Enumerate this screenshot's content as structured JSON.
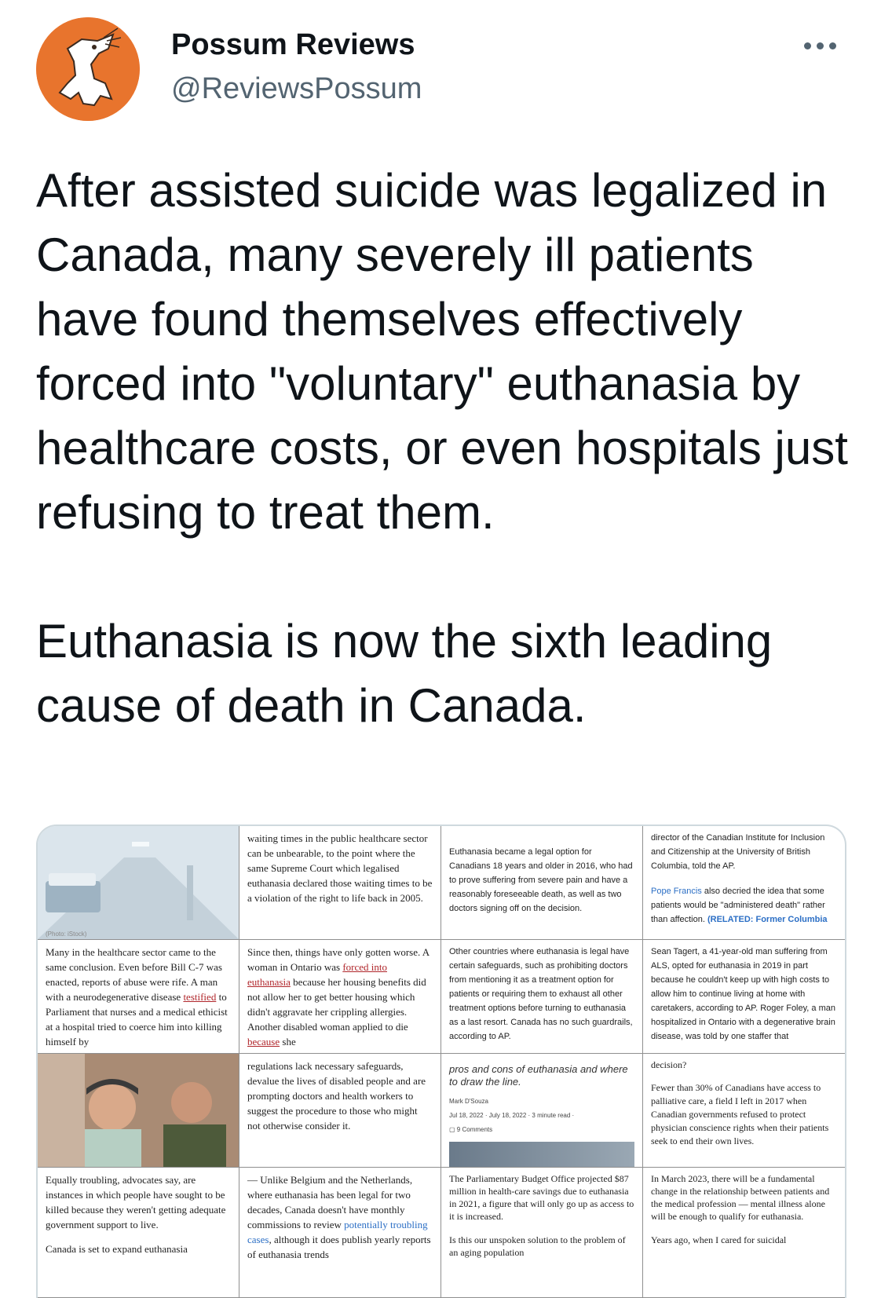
{
  "author": {
    "display_name": "Possum Reviews",
    "handle": "@ReviewsPossum",
    "avatar_icon": "possum-avatar-icon",
    "avatar_bg": "#e8742d"
  },
  "more_icon": "more-options-icon",
  "tweet": {
    "paragraph1": "After assisted suicide was legalized in Canada, many severely ill patients have found themselves effectively forced into \"voluntary\" euthanasia by healthcare costs, or even hospitals just refusing to treat them.",
    "paragraph2": "Euthanasia is now the sixth leading cause of death in Canada."
  },
  "collage": {
    "c1_credit": "(Photo: iStock)",
    "c2_text": "waiting times in the public healthcare sector can be unbearable, to the point where the same Supreme Court which legalised euthanasia declared those waiting times to be a violation of the right to life back in 2005.",
    "c3_text": "Euthanasia became a legal option for Canadians 18 years and older in 2016, who had to prove suffering from severe pain and have a reasonably foreseeable death, as well as two doctors signing off on the decision.",
    "c4_a": "director of the Canadian Institute for Inclusion and Citizenship at the University of British Columbia, told the AP.",
    "c4_b_link": "Pope Francis",
    "c4_b": " also decried the idea that some patients would be \"administered death\" rather than affection.",
    "c4_related": "(RELATED: Former Columbia",
    "c5_pre": "Many in the healthcare sector came to the same conclusion. Even before Bill C-7 was enacted, reports of abuse were rife. A man with a neurodegenerative disease ",
    "c5_link": "testified",
    "c5_post": " to Parliament that nurses and a medical ethicist at a hospital tried to coerce him into killing himself by",
    "c6_pre": "Since then, things have only gotten worse. A woman in Ontario was ",
    "c6_link": "forced into euthanasia",
    "c6_mid": " because her housing benefits did not allow her to get better housing which didn't aggravate her crippling allergies. Another disabled woman applied to die ",
    "c6_link2": "because",
    "c6_post": " she",
    "c7_text": "Other countries where euthanasia is legal have certain safeguards, such as prohibiting doctors from mentioning it as a treatment option for patients or requiring them to exhaust all other treatment options before turning to euthanasia as a last resort. Canada has no such guardrails, according to AP.",
    "c8_text": "Sean Tagert, a 41-year-old man suffering from ALS, opted for euthanasia in 2019 in part because he couldn't keep up with high costs to allow him to continue living at home with caretakers, according to AP. Roger Foley, a man hospitalized in Ontario with a degenerative brain disease, was told by one staffer that",
    "c10_text": "regulations lack necessary safeguards, devalue the lives of disabled people and are prompting doctors and health workers to suggest the procedure to those who might not otherwise consider it.",
    "c11_headline": "pros and cons of euthanasia and where to draw the line.",
    "c11_author": "Mark D'Souza",
    "c11_meta": "Jul 18, 2022 · July 18, 2022 · 3 minute read ·",
    "c11_comments": "9 Comments",
    "c12_a": "decision?",
    "c12_b": "Fewer than 30% of Canadians have access to palliative care, a field I left in 2017 when Canadian governments refused to protect physician conscience rights when their patients seek to end their own lives.",
    "c13_text": "Equally troubling, advocates say, are instances in which people have sought to be killed because they weren't getting adequate government support to live.",
    "c13_tail": "Canada is set to expand euthanasia",
    "c14_pre": "— Unlike Belgium and the Netherlands, where euthanasia has been legal for two decades, Canada doesn't have monthly commissions to review ",
    "c14_link": "potentially troubling cases",
    "c14_post": ", although it does publish yearly reports of euthanasia trends",
    "c15_a": "The Parliamentary Budget Office projected $87 million in health-care savings due to euthanasia in 2021, a figure that will only go up as access to it is increased.",
    "c15_b": "Is this our unspoken solution to the problem of an aging population",
    "c16_a": "In March 2023, there will be a fundamental change in the relationship between patients and the medical profession — mental illness alone will be enough to qualify for euthanasia.",
    "c16_b": "Years ago, when I cared for suicidal"
  }
}
